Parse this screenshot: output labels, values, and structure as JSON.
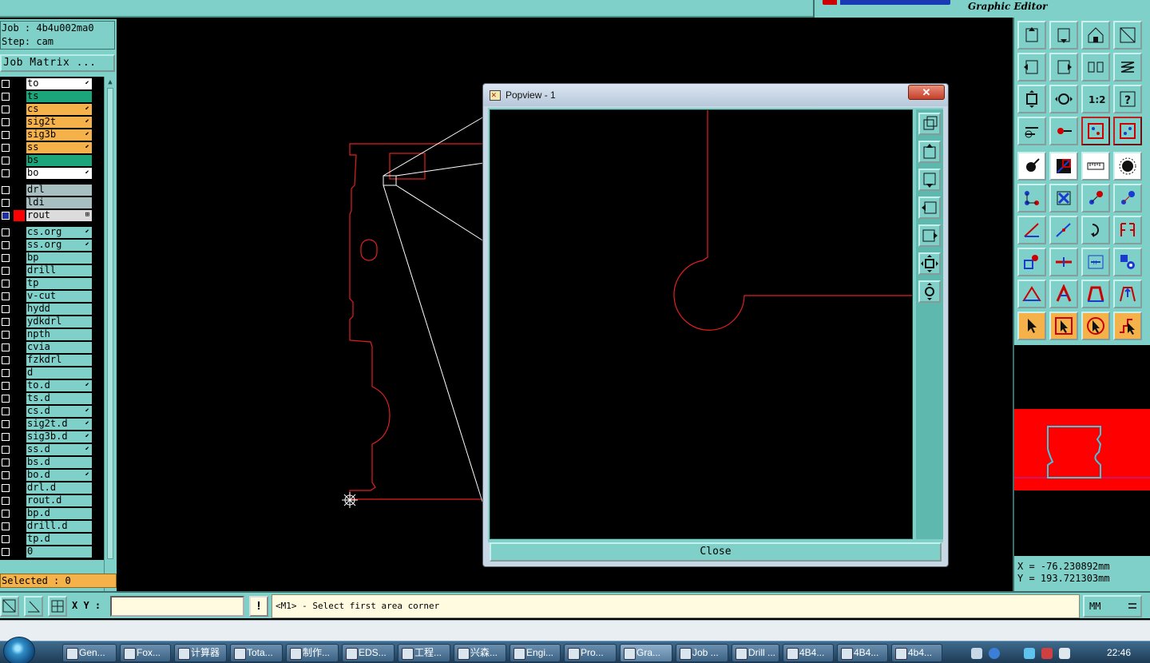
{
  "app": {
    "title": "Graphic Editor"
  },
  "job": {
    "line1": "Job : 4b4u002ma0",
    "line2": "Step: cam",
    "matrix_label": "Job Matrix ..."
  },
  "layers": [
    {
      "name": "to",
      "fill": "#ffffff",
      "flag": "⬋",
      "checked": false,
      "color": "#000000"
    },
    {
      "name": "ts",
      "fill": "#1aa57a",
      "flag": "",
      "checked": false,
      "color": "#000000"
    },
    {
      "name": "cs",
      "fill": "#f6b24a",
      "flag": "⬋",
      "checked": false,
      "color": "#000000"
    },
    {
      "name": "sig2t",
      "fill": "#f6b24a",
      "flag": "⬋",
      "checked": false,
      "color": "#000000"
    },
    {
      "name": "sig3b",
      "fill": "#f6b24a",
      "flag": "⬋",
      "checked": false,
      "color": "#000000"
    },
    {
      "name": "ss",
      "fill": "#f6b24a",
      "flag": "⬋",
      "checked": false,
      "color": "#000000"
    },
    {
      "name": "bs",
      "fill": "#1aa57a",
      "flag": "",
      "checked": false,
      "color": "#000000"
    },
    {
      "name": "bo",
      "fill": "#ffffff",
      "flag": "⬋",
      "checked": false,
      "color": "#000000"
    },
    {
      "name": "drl",
      "fill": "#a8bfc2",
      "flag": "",
      "checked": false,
      "color": "#000000",
      "gap": true
    },
    {
      "name": "ldi",
      "fill": "#a8bfc2",
      "flag": "",
      "checked": false,
      "color": "#000000"
    },
    {
      "name": "rout",
      "fill": "#dcdcdc",
      "flag": "⊞",
      "checked": true,
      "color": "#ff0000"
    },
    {
      "name": "cs.org",
      "fill": "#7fd0c8",
      "flag": "⬋",
      "checked": false,
      "color": "#000000",
      "gap": true
    },
    {
      "name": "ss.org",
      "fill": "#7fd0c8",
      "flag": "⬋",
      "checked": false,
      "color": "#000000"
    },
    {
      "name": "bp",
      "fill": "#7fd0c8",
      "flag": "",
      "checked": false,
      "color": "#000000"
    },
    {
      "name": "drill",
      "fill": "#7fd0c8",
      "flag": "",
      "checked": false,
      "color": "#000000"
    },
    {
      "name": "tp",
      "fill": "#7fd0c8",
      "flag": "",
      "checked": false,
      "color": "#000000"
    },
    {
      "name": "v-cut",
      "fill": "#7fd0c8",
      "flag": "",
      "checked": false,
      "color": "#000000"
    },
    {
      "name": "hydd",
      "fill": "#7fd0c8",
      "flag": "",
      "checked": false,
      "color": "#000000"
    },
    {
      "name": "ydkdrl",
      "fill": "#7fd0c8",
      "flag": "",
      "checked": false,
      "color": "#000000"
    },
    {
      "name": "npth",
      "fill": "#7fd0c8",
      "flag": "",
      "checked": false,
      "color": "#000000"
    },
    {
      "name": "cvia",
      "fill": "#7fd0c8",
      "flag": "",
      "checked": false,
      "color": "#000000"
    },
    {
      "name": "fzkdrl",
      "fill": "#7fd0c8",
      "flag": "",
      "checked": false,
      "color": "#000000"
    },
    {
      "name": "d",
      "fill": "#7fd0c8",
      "flag": "",
      "checked": false,
      "color": "#000000"
    },
    {
      "name": "to.d",
      "fill": "#7fd0c8",
      "flag": "⬋",
      "checked": false,
      "color": "#000000"
    },
    {
      "name": "ts.d",
      "fill": "#7fd0c8",
      "flag": "",
      "checked": false,
      "color": "#000000"
    },
    {
      "name": "cs.d",
      "fill": "#7fd0c8",
      "flag": "⬋",
      "checked": false,
      "color": "#000000"
    },
    {
      "name": "sig2t.d",
      "fill": "#7fd0c8",
      "flag": "⬋",
      "checked": false,
      "color": "#000000"
    },
    {
      "name": "sig3b.d",
      "fill": "#7fd0c8",
      "flag": "⬋",
      "checked": false,
      "color": "#000000"
    },
    {
      "name": "ss.d",
      "fill": "#7fd0c8",
      "flag": "⬋",
      "checked": false,
      "color": "#000000"
    },
    {
      "name": "bs.d",
      "fill": "#7fd0c8",
      "flag": "",
      "checked": false,
      "color": "#000000"
    },
    {
      "name": "bo.d",
      "fill": "#7fd0c8",
      "flag": "⬋",
      "checked": false,
      "color": "#000000"
    },
    {
      "name": "drl.d",
      "fill": "#7fd0c8",
      "flag": "",
      "checked": false,
      "color": "#000000"
    },
    {
      "name": "rout.d",
      "fill": "#7fd0c8",
      "flag": "",
      "checked": false,
      "color": "#000000"
    },
    {
      "name": "bp.d",
      "fill": "#7fd0c8",
      "flag": "",
      "checked": false,
      "color": "#000000"
    },
    {
      "name": "drill.d",
      "fill": "#7fd0c8",
      "flag": "",
      "checked": false,
      "color": "#000000"
    },
    {
      "name": "tp.d",
      "fill": "#7fd0c8",
      "flag": "",
      "checked": false,
      "color": "#000000"
    },
    {
      "name": "0",
      "fill": "#7fd0c8",
      "flag": "",
      "checked": false,
      "color": "#000000"
    }
  ],
  "status": {
    "selected": "Selected : 0"
  },
  "popview": {
    "title": "Popview - 1",
    "close_x": "x",
    "close_button": "Close"
  },
  "coords": {
    "x": "X = -76.230892mm",
    "y": "Y = 193.721303mm"
  },
  "command": {
    "xy_label": "X Y :",
    "xy_value": "",
    "alert": "!",
    "prompt": "<M1> - Select first area corner",
    "unit": "MM"
  },
  "palette_icons": [
    "move-up-icon",
    "move-down-icon",
    "home-icon",
    "fit-window-icon",
    "pan-left-icon",
    "pan-right-icon",
    "mirror-icon",
    "spiral-icon",
    "zoom-fit-icon",
    "zoom-center-icon",
    "scale-1-2-icon",
    "help-icon",
    "measure-icon",
    "key-icon",
    "layer-red-icon",
    "layer-blue-icon",
    "pad-icon",
    "snap-icon",
    "ruler-icon",
    "drill-hole-icon",
    "connect-icon",
    "cross-pad-icon",
    "arrow-pad-icon",
    "arrow-pad-blue-icon",
    "line-red-icon",
    "line-blue-icon",
    "arc-icon",
    "flip-icon",
    "pad-select-icon",
    "bar-icon",
    "dimension-icon",
    "group-icon",
    "triangle-plus-icon",
    "triangle-a-icon",
    "trapezoid-a-icon",
    "trapezoid-arrow-icon",
    "cursor-icon",
    "cursor-box-icon",
    "cursor-circle-icon",
    "cursor-step-icon"
  ],
  "popview_tools": [
    "zoom-in-icon",
    "pan-up-icon",
    "pan-down-icon",
    "pan-left-icon",
    "pan-right-icon",
    "zoom-out-icon",
    "zoom-fit-icon"
  ],
  "taskbar": {
    "items": [
      "Gen...",
      "Fox...",
      "计算器",
      "Tota...",
      "制作...",
      "EDS...",
      "工程...",
      "兴森...",
      "Engi...",
      "Pro...",
      "Gra...",
      "Job ...",
      "Drill ...",
      "4B4...",
      "4B4...",
      "4b4..."
    ],
    "clock": "22:46"
  },
  "colors": {
    "teal": "#7fd0c8",
    "orange": "#f6b24a",
    "rout": "#ff0000",
    "navigator_fill": "#ff0000"
  }
}
